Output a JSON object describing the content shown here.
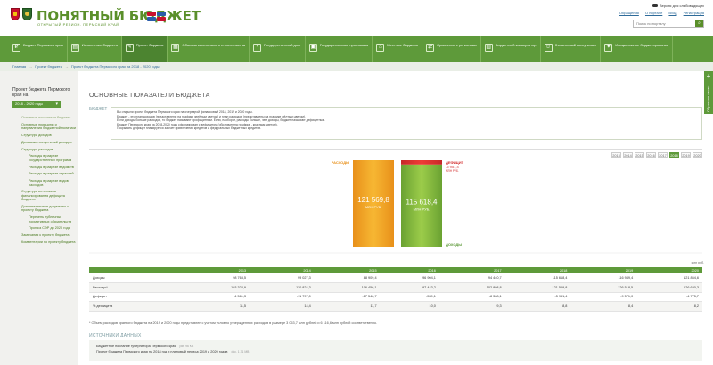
{
  "header": {
    "logo_title": "ПОНЯТНЫЙ БЮДЖЕТ",
    "logo_subtitle": "ОТКРЫТЫЙ РЕГИОН. ПЕРМСКИЙ КРАЙ",
    "accessibility_link": "Версия для слабовидящих",
    "links": [
      "Обращения",
      "О портале",
      "Вход",
      "Регистрация"
    ],
    "search_placeholder": "Поиск по порталу"
  },
  "nav": {
    "items": [
      {
        "label": "Бюджет Пермского края",
        "icon": "₽"
      },
      {
        "label": "Исполнение бюджета",
        "icon": "▤"
      },
      {
        "label": "Проект бюджета",
        "icon": "✎"
      },
      {
        "label": "Объекты капитального строительства",
        "icon": "▦"
      },
      {
        "label": "Государственный долг",
        "icon": "◔"
      },
      {
        "label": "Государственные программы",
        "icon": "▣"
      },
      {
        "label": "Местные бюджеты",
        "icon": "⌂"
      },
      {
        "label": "Сравнение с регионами",
        "icon": "⇄"
      },
      {
        "label": "Бюджетный калькулятор",
        "icon": "▥"
      },
      {
        "label": "Финансовый консультант",
        "icon": "☺"
      },
      {
        "label": "Инициативное бюджетирование",
        "icon": "✦"
      }
    ]
  },
  "breadcrumbs": [
    "Главная",
    "Проект бюджета",
    "Проект бюджета Пермского края на 2018 - 2020 годы"
  ],
  "sidebar": {
    "title": "Проект бюджета Пермского края на",
    "selected_period": "2018 - 2020 годы",
    "items": [
      {
        "label": "Основные показатели бюджета",
        "sub": false,
        "active": true
      },
      {
        "label": "Основные принципы и направления бюджетной политики",
        "sub": false,
        "active": false
      },
      {
        "label": "Структура доходов",
        "sub": false,
        "active": false
      },
      {
        "label": "Динамика поступлений доходов",
        "sub": false,
        "active": false
      },
      {
        "label": "Структура расходов",
        "sub": false,
        "active": false
      },
      {
        "label": "Расходы в разрезе государственных программ",
        "sub": true,
        "active": false
      },
      {
        "label": "Расходы в разрезе ведомств",
        "sub": true,
        "active": false
      },
      {
        "label": "Расходы в разрезе отраслей",
        "sub": true,
        "active": false
      },
      {
        "label": "Расходы в разрезе видов расходов",
        "sub": true,
        "active": false
      },
      {
        "label": "Структура источников финансирования дефицита бюджета",
        "sub": false,
        "active": false
      },
      {
        "label": "Дополнительные документы к проекту бюджета",
        "sub": false,
        "active": false
      },
      {
        "label": "Перечень публичных нормативных обязательств",
        "sub": true,
        "active": false
      },
      {
        "label": "Прогноз СЭР до 2020 года",
        "sub": true,
        "active": false
      },
      {
        "label": "Замечания к проекту бюджета",
        "sub": false,
        "active": false
      },
      {
        "label": "Комментарии по проекту бюджета",
        "sub": false,
        "active": false
      }
    ]
  },
  "main": {
    "title": "ОСНОВНЫЕ ПОКАЗАТЕЛИ БЮДЖЕТА",
    "tab": "БЮДЖЕТ",
    "info": [
      "Вы открыли проект бюджета Пермского края на очередной финансовый 2018, 2019 и 2020 годы.",
      "Бюджет - это план доходов (представлены на графике зелёным цветом) и план расходов (представлены на графике жёлтым цветом).",
      "Если доходы больше расходов, то бюджет называют профицитным. Если, наоборот, расходы больше, чем доходы, бюджет называют дефицитным.",
      "Бюджет Пермского края на 2018-2020 годы сформирован с дефицитом (обозначен на графике - красным цветом).",
      "Покрывать дефицит планируется за счет привлечения кредитов и федеральных бюджетных кредитов."
    ],
    "years": [
      "2013",
      "2014",
      "2015",
      "2016",
      "2017",
      "2018",
      "2019",
      "2020"
    ],
    "active_year": "2018",
    "units": "млн руб.",
    "table": {
      "headers": [
        "",
        "2013",
        "2014",
        "2015",
        "2016",
        "2017",
        "2018",
        "2019",
        "2020"
      ],
      "rows": [
        [
          "Доходы",
          "98 763,5",
          "99 027,3",
          "88 909,4",
          "96 904,1",
          "94 440,7",
          "115 618,4",
          "116 949,4",
          "121 854,6"
        ],
        [
          "Расходы*",
          "103 324,9",
          "110 824,3",
          "106 456,1",
          "97 443,2",
          "102 808,8",
          "121 569,8",
          "126 518,5",
          "126 630,3"
        ],
        [
          "Дефицит",
          "-4 561,3",
          "-11 797,0",
          "-17 546,7",
          "-539,1",
          "-8 368,1",
          "-5 951,4",
          "-9 571,0",
          "-4 775,7"
        ],
        [
          "% дефицита",
          "11,5",
          "14,4",
          "11,7",
          "10,0",
          "9,3",
          "8,8",
          "8,4",
          "8,2"
        ]
      ]
    },
    "footnote": "* Объем расходов краевого бюджета на 2019 и 2020 годы представлен с учетом условно утвержденных расходов в размере 3 053,7 млн рублей и 6 116,6 млн рублей соответственно.",
    "sources_title": "ИСТОЧНИКИ ДАННЫХ",
    "sources": [
      {
        "label": "Бюджетное послание губернатора Пермского края",
        "size": "pdf, 96 KB"
      },
      {
        "label": "Проект бюджета Пермского края на 2018 год и плановый период 2019 и 2020 годов",
        "size": "doc, 1,71 MB"
      }
    ],
    "feedback": "Обратная связь"
  },
  "chart_data": {
    "type": "bar",
    "year": "2018",
    "categories": [
      "РАСХОДЫ",
      "ДОХОДЫ"
    ],
    "series": [
      {
        "name": "РАСХОДЫ",
        "values": [
          121569.8
        ],
        "label": "121 569,8",
        "unit": "МЛН РУБ.",
        "color": "#f2a21e"
      },
      {
        "name": "ДОХОДЫ",
        "values": [
          115618.4
        ],
        "label": "115 618,4",
        "unit": "МЛН РУБ.",
        "color": "#7cb342"
      },
      {
        "name": "ДЕФИЦИТ",
        "values": [
          5951.4
        ],
        "label": "-5 951,4",
        "unit": "МЛН РУБ.",
        "color": "#d32f2f"
      }
    ],
    "ylim": [
      0,
      121569.8
    ]
  }
}
